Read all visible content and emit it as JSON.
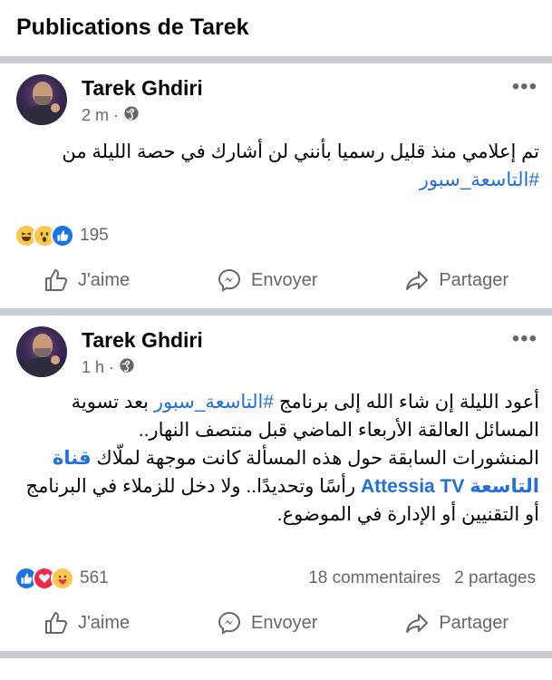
{
  "header": {
    "title": "Publications de Tarek"
  },
  "posts": [
    {
      "author": "Tarek Ghdiri",
      "time": "2 m",
      "dot": "·",
      "more": "•••",
      "line1": "تم إعلامي منذ قليل رسميا بأنني لن أشارك في حصة الليلة من",
      "hashtag": "#التاسعة_سبور",
      "reaction_icons": [
        "haha",
        "wow",
        "like"
      ],
      "reaction_count": "195",
      "comments": "",
      "shares": "",
      "actions": {
        "like": "J'aime",
        "send": "Envoyer",
        "share": "Partager"
      }
    },
    {
      "author": "Tarek Ghdiri",
      "time": "1 h",
      "dot": "·",
      "more": "•••",
      "p1_a": "أعود الليلة إن شاء الله إلى برنامج ",
      "p1_tag": "#التاسعة_سبور",
      "p1_b": " بعد تسوية المسائل العالقة الأربعاء الماضي قبل منتصف النهار..",
      "p2_a": "المنشورات السابقة حول هذه المسألة كانت موجهة لملّاك ",
      "p2_link": "قناة التاسعة Attessia TV",
      "p2_b": " رأسًا وتحديدًا.. ولا دخل للزملاء في البرنامج أو التقنيين أو الإدارة في الموضوع.",
      "reaction_icons": [
        "like",
        "love",
        "care"
      ],
      "reaction_count": "561",
      "comments": "18 commentaires",
      "shares": "2 partages",
      "actions": {
        "like": "J'aime",
        "send": "Envoyer",
        "share": "Partager"
      }
    }
  ],
  "colors": {
    "accent": "#216fdb",
    "muted": "#65676b",
    "separator": "#c9ccd1"
  }
}
